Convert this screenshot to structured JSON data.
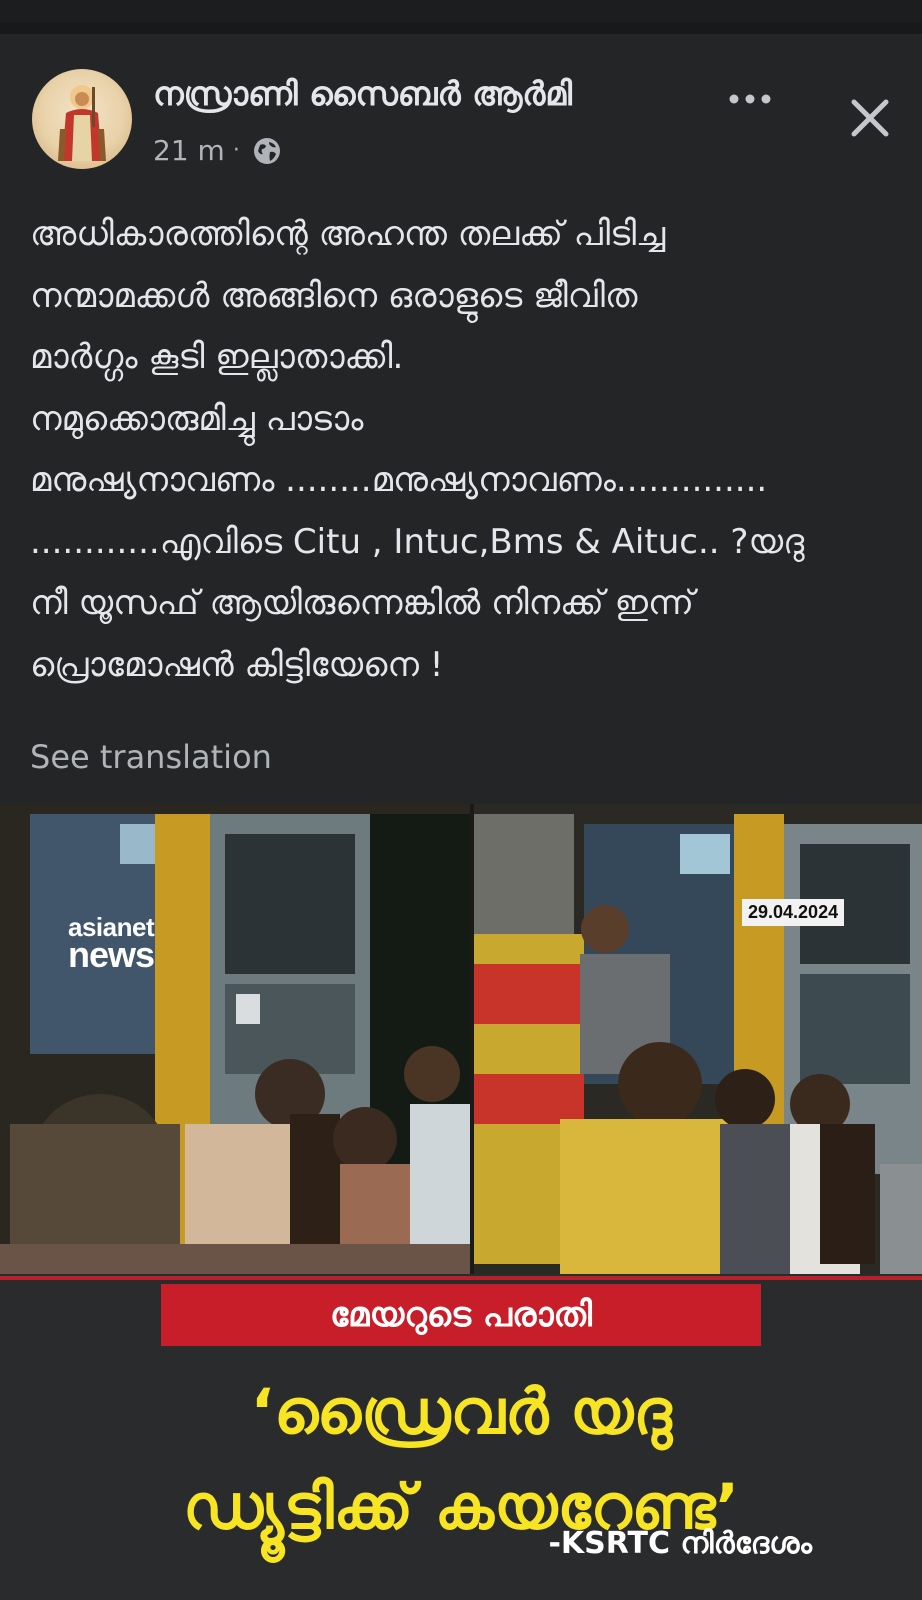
{
  "post": {
    "author": "നസ്രാണി സൈബർ ആർമി",
    "time": "21 m",
    "separator": "·",
    "privacy_icon": "globe-icon",
    "more_icon": "ellipsis-icon",
    "close_icon": "close-icon",
    "text_lines": [
      "അധികാരത്തിന്റെ അഹന്ത തലക്ക് പിടിച്ച",
      "നന്മാമക്കൾ അങ്ങിനെ ഒരാളുടെ ജീവിത",
      "മാർഗ്ഗം കൂടി ഇല്ലാതാക്കി.",
      "നമുക്കൊരുമിച്ചു പാടാം",
      "മനുഷ്യനാവണം ........മനുഷ്യനാവണം..............",
      "............എവിടെ Citu , Intuc,Bms & Aituc.. ?യദു",
      "നീ യൂസഫ് ആയിരുന്നെങ്കിൽ നിനക്ക് ഇന്ന്",
      "പ്രൊമോഷൻ കിട്ടിയേനെ !"
    ],
    "see_translation": "See translation"
  },
  "media": {
    "channel_logo_line1": "asianet",
    "channel_logo_line2": "news",
    "date_stamp": "29.04.2024",
    "red_bar_text": "മേയറുടെ പരാതി",
    "headline_line1": "‘ഡ്രൈവർ യദു",
    "headline_line2": "ഡ്യൂട്ടിക്ക് കയറേണ്ട’",
    "attribution": "-KSRTC നിർദേശം"
  },
  "colors": {
    "background": "#242526",
    "text": "#e4e6eb",
    "secondary_text": "#b0b3b8",
    "red_bar": "#c81e2a",
    "headline_yellow": "#f7e423"
  }
}
